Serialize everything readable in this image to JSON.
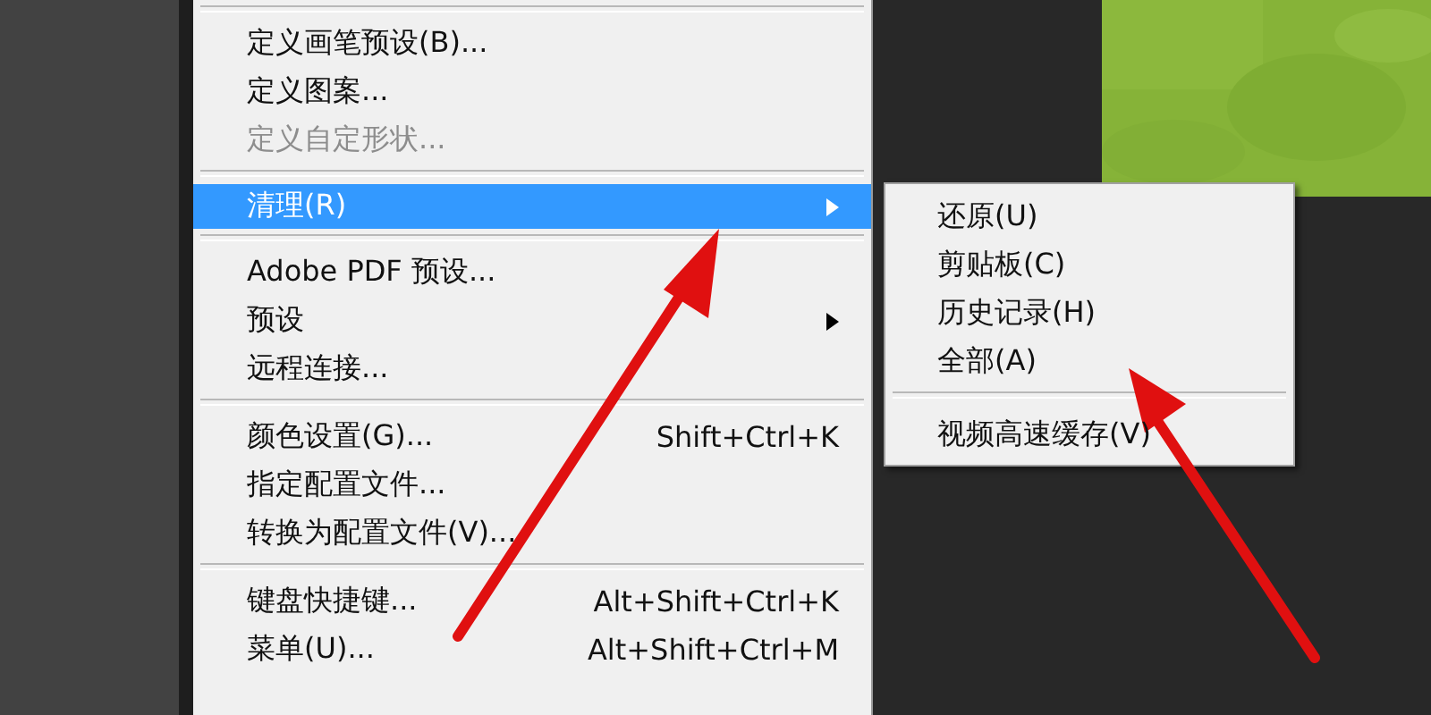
{
  "menu": {
    "items": [
      {
        "kind": "separator"
      },
      {
        "kind": "item",
        "label": "定义画笔预设(B)...",
        "disabled": false,
        "selected": false,
        "has_submenu": false
      },
      {
        "kind": "item",
        "label": "定义图案...",
        "disabled": false,
        "selected": false,
        "has_submenu": false
      },
      {
        "kind": "item",
        "label": "定义自定形状...",
        "disabled": true,
        "selected": false,
        "has_submenu": false
      },
      {
        "kind": "separator"
      },
      {
        "kind": "item",
        "label": "清理(R)",
        "disabled": false,
        "selected": true,
        "has_submenu": true
      },
      {
        "kind": "separator"
      },
      {
        "kind": "item",
        "label": "Adobe PDF 预设...",
        "disabled": false,
        "selected": false,
        "has_submenu": false
      },
      {
        "kind": "item",
        "label": "预设",
        "disabled": false,
        "selected": false,
        "has_submenu": true
      },
      {
        "kind": "item",
        "label": "远程连接...",
        "disabled": false,
        "selected": false,
        "has_submenu": false
      },
      {
        "kind": "separator"
      },
      {
        "kind": "item",
        "label": "颜色设置(G)...",
        "shortcut": "Shift+Ctrl+K",
        "disabled": false,
        "selected": false,
        "has_submenu": false
      },
      {
        "kind": "item",
        "label": "指定配置文件...",
        "disabled": false,
        "selected": false,
        "has_submenu": false
      },
      {
        "kind": "item",
        "label": "转换为配置文件(V)...",
        "disabled": false,
        "selected": false,
        "has_submenu": false
      },
      {
        "kind": "separator"
      },
      {
        "kind": "item",
        "label": "键盘快捷键...",
        "shortcut": "Alt+Shift+Ctrl+K",
        "disabled": false,
        "selected": false,
        "has_submenu": false
      },
      {
        "kind": "item",
        "label": "菜单(U)...",
        "shortcut": "Alt+Shift+Ctrl+M",
        "disabled": false,
        "selected": false,
        "has_submenu": false
      }
    ]
  },
  "submenu": {
    "items": [
      {
        "kind": "item",
        "label": "还原(U)"
      },
      {
        "kind": "item",
        "label": "剪贴板(C)"
      },
      {
        "kind": "item",
        "label": "历史记录(H)"
      },
      {
        "kind": "item",
        "label": "全部(A)"
      },
      {
        "kind": "separator"
      },
      {
        "kind": "item",
        "label": "视频高速缓存(V)"
      }
    ]
  }
}
